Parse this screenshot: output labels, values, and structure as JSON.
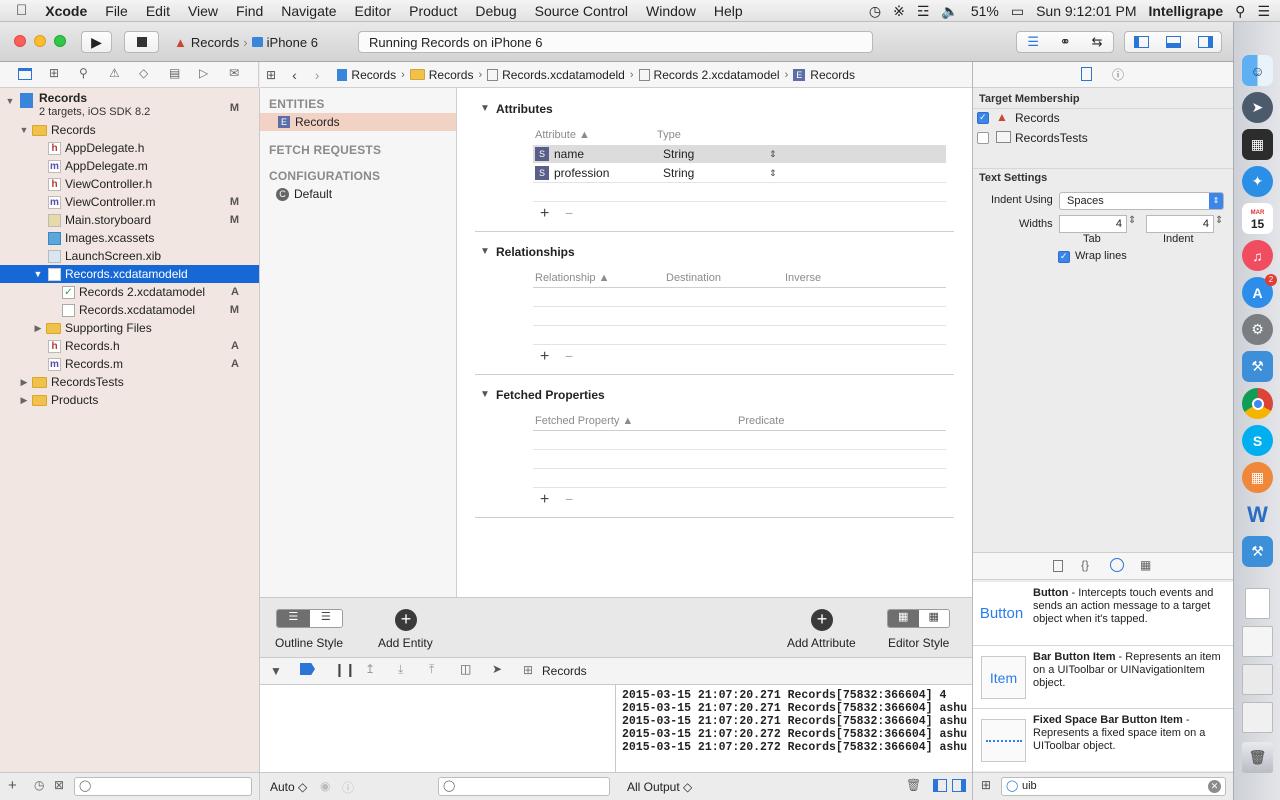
{
  "menubar": {
    "items": [
      "Xcode",
      "File",
      "Edit",
      "View",
      "Find",
      "Navigate",
      "Editor",
      "Product",
      "Debug",
      "Source Control",
      "Window",
      "Help"
    ],
    "battery": "51%",
    "clock": "Sun 9:12:01 PM",
    "user": "Intelligrape"
  },
  "toolbar": {
    "scheme": "Records",
    "device": "iPhone 6",
    "status": "Running Records on iPhone 6"
  },
  "pathbar": {
    "crumbs": [
      "Records",
      "Records",
      "Records.xcdatamodeld",
      "Records 2.xcdatamodel",
      "Records"
    ]
  },
  "navigator": {
    "project": {
      "name": "Records",
      "subtitle": "2 targets, iOS SDK 8.2",
      "badge": "M"
    },
    "rows": [
      {
        "label": "Records",
        "badge": ""
      },
      {
        "label": "AppDelegate.h",
        "badge": "",
        "icon": "h"
      },
      {
        "label": "AppDelegate.m",
        "badge": "",
        "icon": "m"
      },
      {
        "label": "ViewController.h",
        "badge": "",
        "icon": "h"
      },
      {
        "label": "ViewController.m",
        "badge": "M",
        "icon": "m"
      },
      {
        "label": "Main.storyboard",
        "badge": "M"
      },
      {
        "label": "Images.xcassets",
        "badge": ""
      },
      {
        "label": "LaunchScreen.xib",
        "badge": ""
      },
      {
        "label": "Records.xcdatamodeld",
        "badge": ""
      },
      {
        "label": "Records 2.xcdatamodel",
        "badge": "A"
      },
      {
        "label": "Records.xcdatamodel",
        "badge": "M"
      },
      {
        "label": "Supporting Files",
        "badge": ""
      },
      {
        "label": "Records.h",
        "badge": "A",
        "icon": "h"
      },
      {
        "label": "Records.m",
        "badge": "A",
        "icon": "m"
      },
      {
        "label": "RecordsTests",
        "badge": ""
      },
      {
        "label": "Products",
        "badge": ""
      }
    ]
  },
  "entities": {
    "entities_header": "ENTITIES",
    "entity": "Records",
    "fetch_header": "FETCH REQUESTS",
    "config_header": "CONFIGURATIONS",
    "config": "Default"
  },
  "editor": {
    "attributes": {
      "title": "Attributes",
      "col1": "Attribute",
      "col2": "Type",
      "rows": [
        {
          "name": "name",
          "type": "String"
        },
        {
          "name": "profession",
          "type": "String"
        }
      ]
    },
    "relationships": {
      "title": "Relationships",
      "col1": "Relationship",
      "col2": "Destination",
      "col3": "Inverse"
    },
    "fetched": {
      "title": "Fetched Properties",
      "col1": "Fetched Property",
      "col2": "Predicate"
    },
    "plus": "+",
    "minus": "−"
  },
  "footer": {
    "outline": "Outline Style",
    "add_entity": "Add Entity",
    "add_attribute": "Add Attribute",
    "editor_style": "Editor Style"
  },
  "debug": {
    "target": "Records",
    "auto": "Auto ◇",
    "output": "All Output ◇"
  },
  "console": {
    "lines": [
      "2015-03-15 21:07:20.271 Records[75832:366604] 4",
      "2015-03-15 21:07:20.271 Records[75832:366604] ashu",
      "2015-03-15 21:07:20.271 Records[75832:366604] ashu",
      "2015-03-15 21:07:20.272 Records[75832:366604] ashu",
      "2015-03-15 21:07:20.272 Records[75832:366604] ashu"
    ]
  },
  "inspector": {
    "target_header": "Target Membership",
    "targets": [
      {
        "label": "Records",
        "checked": true
      },
      {
        "label": "RecordsTests",
        "checked": false
      }
    ],
    "text_header": "Text Settings",
    "indent_label": "Indent Using",
    "indent_value": "Spaces",
    "widths_label": "Widths",
    "tab_value": "4",
    "indent_width": "4",
    "tab_label": "Tab",
    "indent_sub": "Indent",
    "wrap_label": "Wrap lines",
    "library": [
      {
        "icon": "Button",
        "title": "Button",
        "desc": " - Intercepts touch events and sends an action message to a target object when it's tapped."
      },
      {
        "icon": "Item",
        "title": "Bar Button Item",
        "desc": " - Represents an item on a UIToolbar or UINavigationItem object."
      },
      {
        "icon": "",
        "title": "Fixed Space Bar Button Item",
        "desc": " - Represents a fixed space item on a UIToolbar object."
      }
    ],
    "filter": "uib"
  },
  "dock": {
    "calendar_month": "MAR",
    "calendar_day": "15",
    "badge": "2"
  }
}
